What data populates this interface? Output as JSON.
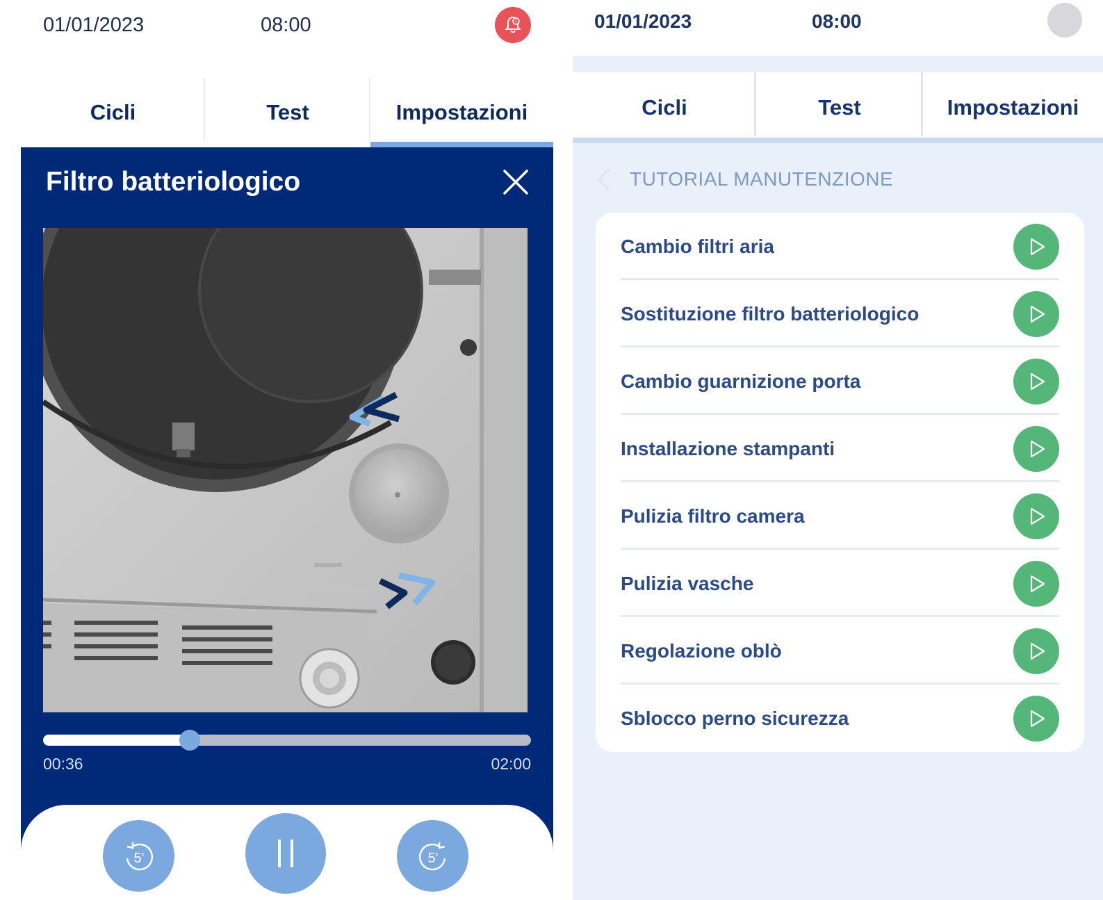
{
  "left": {
    "status": {
      "date": "01/01/2023",
      "time": "08:00"
    },
    "tabs": [
      {
        "label": "Cicli"
      },
      {
        "label": "Test"
      },
      {
        "label": "Impostazioni"
      }
    ],
    "active_tab": "Impostazioni",
    "player": {
      "title": "Filtro batteriologico",
      "elapsed": "00:36",
      "duration": "02:00",
      "progress_fraction": 0.3,
      "rewind_label": "5'",
      "forward_label": "5'"
    }
  },
  "right": {
    "status": {
      "date": "01/01/2023",
      "time": "08:00"
    },
    "tabs": [
      {
        "label": "Cicli"
      },
      {
        "label": "Test"
      },
      {
        "label": "Impostazioni"
      }
    ],
    "active_tab": "Impostazioni",
    "breadcrumb": "TUTORIAL MANUTENZIONE",
    "tutorials": [
      {
        "label": "Cambio filtri aria"
      },
      {
        "label": "Sostituzione filtro batteriologico"
      },
      {
        "label": "Cambio guarnizione porta"
      },
      {
        "label": "Installazione stampanti"
      },
      {
        "label": "Pulizia filtro camera"
      },
      {
        "label": "Pulizia vasche"
      },
      {
        "label": "Regolazione oblò"
      },
      {
        "label": "Sblocco perno sicurezza"
      }
    ]
  },
  "colors": {
    "navy": "#002a77",
    "accent": "#7aa8df",
    "alert": "#e8535a",
    "play": "#55b679",
    "right_bg": "#e9f0fa"
  },
  "icons": [
    "bell-icon",
    "close-icon",
    "rewind-5-icon",
    "pause-icon",
    "forward-5-icon",
    "chevron-left-icon",
    "play-icon"
  ]
}
